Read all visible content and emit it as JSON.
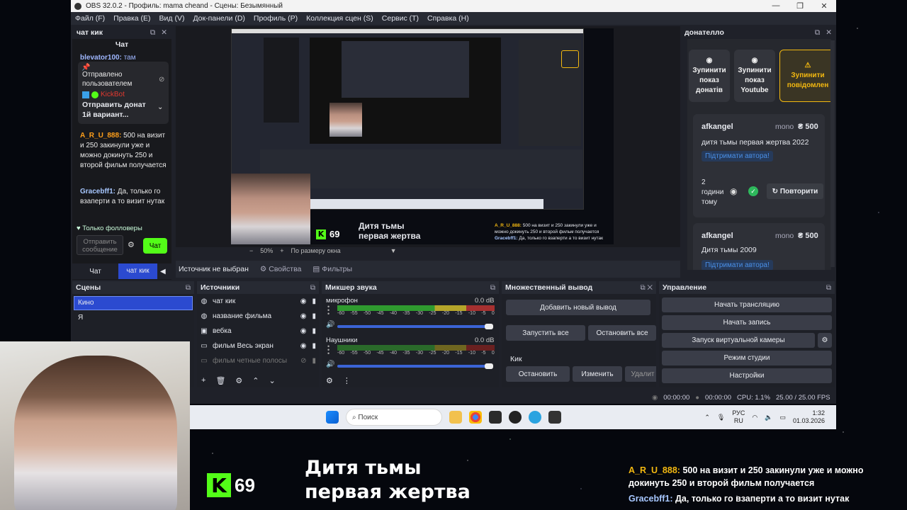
{
  "window": {
    "title": "OBS 32.0.2 - Профиль: mama cheand - Сцены: Безымянный"
  },
  "menu": [
    "Файл (F)",
    "Правка (E)",
    "Вид (V)",
    "Док-панели (D)",
    "Профиль (P)",
    "Коллекция сцен (S)",
    "Сервис (T)",
    "Справка (H)"
  ],
  "chat_dock": {
    "title": "чат кик",
    "header": "Чат",
    "top_user": "blevator100:",
    "top_text": "там",
    "pinned": {
      "line1": "Отправлено",
      "line2": "пользователем",
      "author": "KickBot",
      "text": "Отправить донат 1й вариант..."
    },
    "messages": [
      {
        "user": "A_R_U_888:",
        "text": "500 на визит и 250 закинули уже и можно докинуть 250 и второй фильм получается"
      },
      {
        "user": "Gracebff1:",
        "text": "Да, только го взаперти а то визит нутак"
      }
    ],
    "followers_only": "Только фолловеры",
    "send_placeholder": "Отправить сообщение",
    "send_button": "Чат",
    "tabs": [
      "Чат",
      "чат кик"
    ]
  },
  "preview": {
    "zoom": "50%",
    "zoom_mode": "По размеру окна",
    "no_source": "Источник не выбран",
    "properties": "Свойства",
    "filters": "Фильтры"
  },
  "overlay": {
    "kick_count": "69",
    "movie_line1": "Дитя тьмы",
    "movie_line2": "первая жертва",
    "chat1_user": "A_R_U_888:",
    "chat1_text": "500 на визит и 250 закинули уже и можно докинуть 250 и второй фильм получается",
    "chat2_user": "Gracebff1:",
    "chat2_text": "Да, только го взаперти а то визит нутак"
  },
  "donatello": {
    "title": "донателло",
    "buttons": [
      "Зупинити показ донатів",
      "Зупинити показ Youtube",
      "Зупинити повідомлен"
    ],
    "card1": {
      "user": "afkangel",
      "method": "mono",
      "amount": "₴ 500",
      "message": "дитя тьмы первая жертва 2022",
      "support": "Підтримати автора!",
      "time": "2 години тому",
      "repeat": "Повторити"
    },
    "card2": {
      "user": "afkangel",
      "method": "mono",
      "amount": "₴ 500",
      "message": "Дитя тьмы 2009",
      "support": "Підтримати автора!"
    }
  },
  "scenes": {
    "title": "Сцены",
    "items": [
      "Кино",
      "Я"
    ]
  },
  "sources": {
    "title": "Источники",
    "items": [
      "чат кик",
      "название фильма",
      "вебка",
      "фильм Весь экран",
      "фильм четные полосы"
    ]
  },
  "mixer": {
    "title": "Микшер звука",
    "channels": [
      {
        "name": "микрофон",
        "db": "0.0 dB"
      },
      {
        "name": "Наушники",
        "db": "0.0 dB"
      }
    ],
    "ticks": [
      "-60",
      "-55",
      "-50",
      "-45",
      "-40",
      "-35",
      "-30",
      "-25",
      "-20",
      "-15",
      "-10",
      "-5",
      "0"
    ]
  },
  "multi": {
    "title": "Множественный вывод",
    "add": "Добавить новый вывод",
    "start_all": "Запустить все",
    "stop_all": "Остановить все",
    "target": "Кик",
    "stop": "Остановить",
    "edit": "Изменить",
    "delete": "Удалит"
  },
  "controls": {
    "title": "Управление",
    "buttons": [
      "Начать трансляцию",
      "Начать запись",
      "Запуск виртуальной камеры",
      "Режим студии",
      "Настройки"
    ]
  },
  "status": {
    "time1": "00:00:00",
    "time2": "00:00:00",
    "cpu": "CPU: 1.1%",
    "fps": "25.00 / 25.00 FPS"
  },
  "taskbar": {
    "search": "Поиск",
    "lang1": "РУС",
    "lang2": "RU",
    "time": "1:32",
    "date": "01.03.2026"
  }
}
